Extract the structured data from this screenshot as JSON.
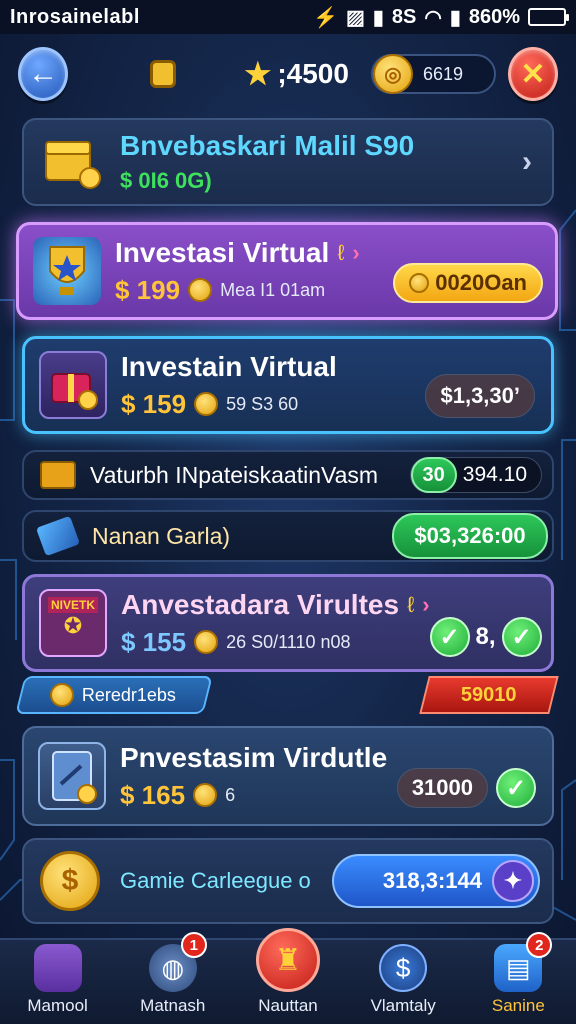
{
  "status_bar": {
    "carrier": "Inrosainelabl",
    "signal_text": "8S",
    "battery_text": "860%",
    "battery_level": 0.86
  },
  "top_bar": {
    "star_score": ";4500",
    "coin_value": "6619"
  },
  "cards": [
    {
      "title": "Bnvebaskari Malil S90",
      "price": "$ 0I6 0G)"
    },
    {
      "title": "Investasi Virtual",
      "price": "$ 199",
      "sub": "Mea I1 01am",
      "pill": "0020Oan"
    },
    {
      "title": "Investain Virtual",
      "price": "$ 159",
      "sub": "59 S3 60",
      "pill": "$1,3,30ʼ"
    },
    {
      "title": "Vaturbh INpateiskaatinVasm",
      "pill_a": "30",
      "pill_b": "394.10"
    },
    {
      "title": "Nanan Garla)",
      "pill": "$03,326:00"
    },
    {
      "title": "Anvestadara Virultes",
      "price": "$ 155",
      "sub": "26 S0/1110 n08",
      "pill": "8,",
      "thumb_label": "NIVETK"
    },
    {
      "title": "Pnvestasim Virdutle",
      "price": "$ 165",
      "sub": "6",
      "pill": "31000"
    },
    {
      "title": "Gamie Carleegue o",
      "pill": "318,3:144"
    }
  ],
  "ribbons": {
    "left": "Reredr1ebs",
    "right": "59010"
  },
  "nav": [
    {
      "label": "Mamool",
      "badge": ""
    },
    {
      "label": "Matnash",
      "badge": "1"
    },
    {
      "label": "Nauttan",
      "badge": ""
    },
    {
      "label": "Vlamtaly",
      "badge": ""
    },
    {
      "label": "Sanine",
      "badge": "2"
    }
  ],
  "colors": {
    "gold": "#ffc43a",
    "cyan": "#5fd8ff",
    "green": "#2ec75a",
    "red": "#c21e17",
    "purple": "#8a4fc9"
  }
}
